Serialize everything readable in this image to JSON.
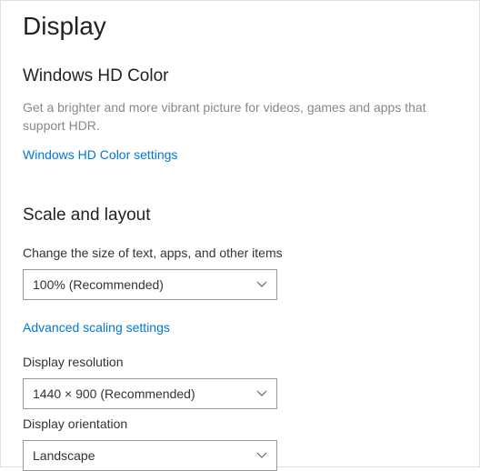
{
  "page_title": "Display",
  "hd_color": {
    "title": "Windows HD Color",
    "description": "Get a brighter and more vibrant picture for videos, games and apps that support HDR.",
    "link_text": "Windows HD Color settings"
  },
  "scale_layout": {
    "title": "Scale and layout",
    "text_size": {
      "label": "Change the size of text, apps, and other items",
      "value": "100% (Recommended)"
    },
    "advanced_link": "Advanced scaling settings",
    "resolution": {
      "label": "Display resolution",
      "value": "1440 × 900 (Recommended)"
    },
    "orientation": {
      "label": "Display orientation",
      "value": "Landscape"
    }
  }
}
